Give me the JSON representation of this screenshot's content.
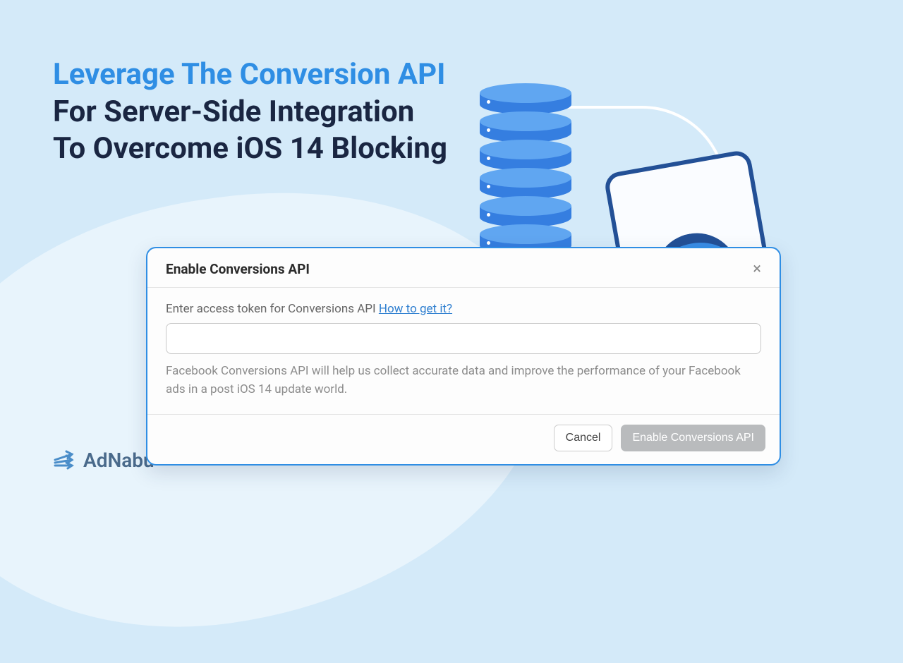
{
  "headline": {
    "accent": "Leverage The Conversion API",
    "rest": " For Server-Side Integration To Overcome iOS 14 Blocking"
  },
  "dialog": {
    "title": "Enable Conversions API",
    "prompt_label": "Enter access token for Conversions API ",
    "prompt_link": "How to get it?",
    "input_value": "",
    "help_text": "Facebook Conversions API will help us collect accurate data and improve the performance of your Facebook ads in a post iOS 14 update world.",
    "cancel_label": "Cancel",
    "enable_label": "Enable Conversions API"
  },
  "brand": {
    "name": "AdNabu"
  },
  "icons": {
    "close": "×"
  }
}
